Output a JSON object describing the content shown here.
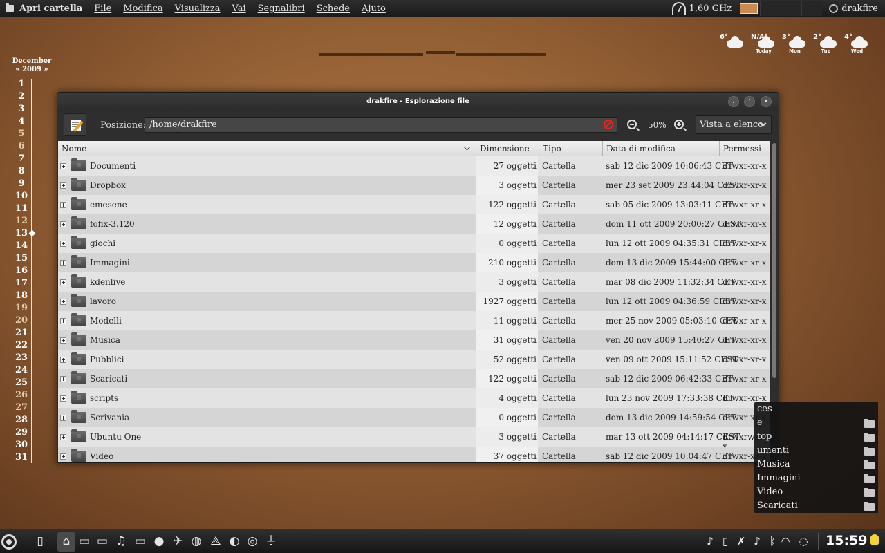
{
  "top_panel": {
    "app_title": "Apri cartella",
    "menu": [
      "File",
      "Modifica",
      "Visualizza",
      "Vai",
      "Segnalibri",
      "Schede",
      "Ajuto"
    ],
    "cpu_freq": "1,60 GHz",
    "username": "drakfire"
  },
  "weather": [
    {
      "temp": "6°",
      "day": ""
    },
    {
      "temp": "N/A°",
      "day": "Today"
    },
    {
      "temp": "3°",
      "day": "Mon"
    },
    {
      "temp": "2°",
      "day": "Tue"
    },
    {
      "temp": "4°",
      "day": "Wed"
    }
  ],
  "calendar": {
    "month": "December",
    "year_nav": "« 2009 »",
    "days": [
      "1",
      "2",
      "3",
      "4",
      "5",
      "6",
      "7",
      "8",
      "9",
      "10",
      "11",
      "12",
      "13",
      "14",
      "15",
      "16",
      "17",
      "18",
      "19",
      "20",
      "21",
      "22",
      "23",
      "24",
      "25",
      "26",
      "27",
      "28",
      "29",
      "30",
      "31"
    ],
    "weekend_days": [
      "5",
      "6",
      "12",
      "19",
      "20",
      "26",
      "27"
    ],
    "today": "13"
  },
  "window": {
    "title": "drakfire - Esplorazione file",
    "location_label": "Posizione:",
    "location_value": "/home/drakfire",
    "zoom": "50%",
    "view_mode": "Vista a elenco",
    "columns": [
      "Nome",
      "Dimensione",
      "Tipo",
      "Data di modifica",
      "Permessi"
    ],
    "files": [
      {
        "name": "Documenti",
        "size": "27 oggetti",
        "type": "Cartella",
        "date": "sab 12 dic 2009 10:06:43 CET",
        "perm": "drwxr-xr-x"
      },
      {
        "name": "Dropbox",
        "size": "3 oggetti",
        "type": "Cartella",
        "date": "mer 23 set 2009 23:44:04 CEST",
        "perm": "drwxr-xr-x"
      },
      {
        "name": "emesene",
        "size": "122 oggetti",
        "type": "Cartella",
        "date": "sab 05 dic 2009 13:03:11 CET",
        "perm": "drwxr-xr-x"
      },
      {
        "name": "fofix-3.120",
        "size": "12 oggetti",
        "type": "Cartella",
        "date": "dom 11 ott 2009 20:00:27 CEST",
        "perm": "drwxr-xr-x"
      },
      {
        "name": "giochi",
        "size": "0 oggetti",
        "type": "Cartella",
        "date": "lun 12 ott 2009 04:35:31 CEST",
        "perm": "drwxr-xr-x"
      },
      {
        "name": "Immagini",
        "size": "210 oggetti",
        "type": "Cartella",
        "date": "dom 13 dic 2009 15:44:00 CET",
        "perm": "drwxr-xr-x"
      },
      {
        "name": "kdenlive",
        "size": "3 oggetti",
        "type": "Cartella",
        "date": "mar 08 dic 2009 11:32:34 CET",
        "perm": "drwxr-xr-x"
      },
      {
        "name": "lavoro",
        "size": "1927 oggetti",
        "type": "Cartella",
        "date": "lun 12 ott 2009 04:36:59 CEST",
        "perm": "drwxr-xr-x"
      },
      {
        "name": "Modelli",
        "size": "11 oggetti",
        "type": "Cartella",
        "date": "mer 25 nov 2009 05:03:10 CET",
        "perm": "drwxr-xr-x"
      },
      {
        "name": "Musica",
        "size": "31 oggetti",
        "type": "Cartella",
        "date": "ven 20 nov 2009 15:40:27 CET",
        "perm": "drwxr-xr-x"
      },
      {
        "name": "Pubblici",
        "size": "52 oggetti",
        "type": "Cartella",
        "date": "ven 09 ott 2009 15:11:52 CEST",
        "perm": "drwxr-xr-x"
      },
      {
        "name": "Scaricati",
        "size": "122 oggetti",
        "type": "Cartella",
        "date": "sab 12 dic 2009 06:42:33 CET",
        "perm": "drwxr-xr-x"
      },
      {
        "name": "scripts",
        "size": "4 oggetti",
        "type": "Cartella",
        "date": "lun 23 nov 2009 17:33:38 CET",
        "perm": "drwxr-xr-x"
      },
      {
        "name": "Scrivania",
        "size": "0 oggetti",
        "type": "Cartella",
        "date": "dom 13 dic 2009 14:59:54 CET",
        "perm": "drwxr-xr-x"
      },
      {
        "name": "Ubuntu One",
        "size": "3 oggetti",
        "type": "Cartella",
        "date": "mar 13 ott 2009 04:14:17 CEST",
        "perm": "drwxrwxr-x"
      },
      {
        "name": "Video",
        "size": "37 oggetti",
        "type": "Cartella",
        "date": "sab 12 dic 2009 10:04:47 CET",
        "perm": "drwxr-xr-x"
      }
    ]
  },
  "places": [
    "ces",
    "e",
    "top",
    "umenti",
    "Musica",
    "Immagini",
    "Video",
    "Scaricati"
  ],
  "clock": "15:59",
  "colors": {
    "accent": "#c98a52",
    "desktop": "#8f5c32"
  }
}
